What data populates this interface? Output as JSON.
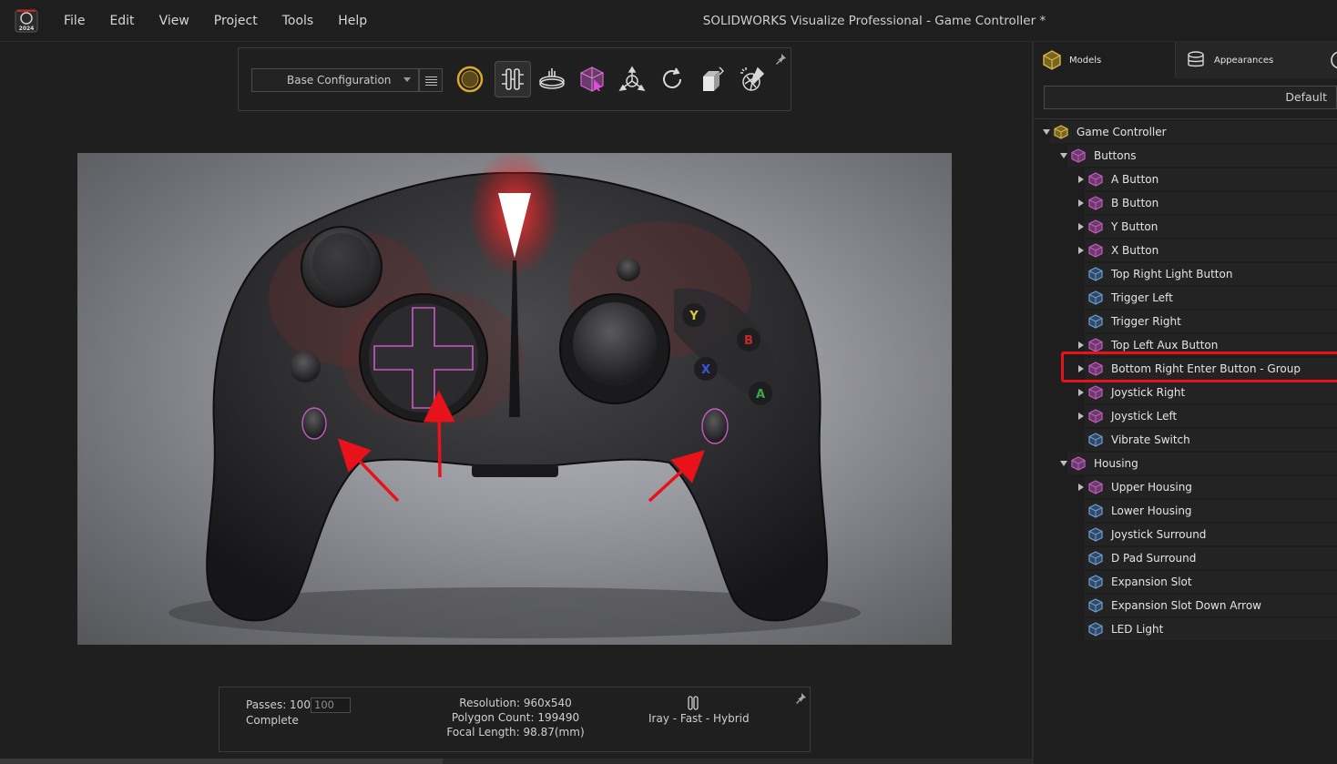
{
  "app": {
    "logo_year": "2024",
    "window_title": "SOLIDWORKS Visualize Professional - Game Controller *"
  },
  "menu": [
    "File",
    "Edit",
    "View",
    "Project",
    "Tools",
    "Help"
  ],
  "toolbar": {
    "configuration": "Base Configuration",
    "icons": [
      "render-mode-icon",
      "scene-tree-icon",
      "turntable-icon",
      "selection-tool-icon",
      "transform-tool-icon",
      "rotate-tool-icon",
      "camera-view-icon",
      "quick-render-icon"
    ]
  },
  "status": {
    "passes_label": "Passes: 100 /",
    "passes_max": "100",
    "state": "Complete",
    "resolution": "Resolution: 960x540",
    "polygons": "Polygon Count: 199490",
    "focal": "Focal Length: 98.87(mm)",
    "renderer": "Iray - Fast - Hybrid"
  },
  "render_overlay": {
    "face_buttons": [
      "Y",
      "B",
      "X",
      "A"
    ]
  },
  "right_panel": {
    "tabs": [
      "Models",
      "Appearances"
    ],
    "state": "Default",
    "tree": [
      {
        "label": "Game Controller",
        "level": 0,
        "toggle": "down",
        "icon": "model-group-icon"
      },
      {
        "label": "Buttons",
        "level": 1,
        "toggle": "down",
        "icon": "group-icon"
      },
      {
        "label": "A Button",
        "level": 2,
        "toggle": "right",
        "icon": "group-icon"
      },
      {
        "label": "B Button",
        "level": 2,
        "toggle": "right",
        "icon": "group-icon"
      },
      {
        "label": "Y Button",
        "level": 2,
        "toggle": "right",
        "icon": "group-icon"
      },
      {
        "label": "X Button",
        "level": 2,
        "toggle": "right",
        "icon": "group-icon"
      },
      {
        "label": "Top Right Light Button",
        "level": 2,
        "toggle": "none",
        "icon": "part-icon"
      },
      {
        "label": "Trigger Left",
        "level": 2,
        "toggle": "none",
        "icon": "part-icon"
      },
      {
        "label": "Trigger Right",
        "level": 2,
        "toggle": "none",
        "icon": "part-icon"
      },
      {
        "label": "Top Left Aux Button",
        "level": 2,
        "toggle": "right",
        "icon": "group-icon"
      },
      {
        "label": "Bottom Right Enter Button - Group",
        "level": 2,
        "toggle": "right",
        "icon": "group-icon",
        "highlighted": true
      },
      {
        "label": "Joystick Right",
        "level": 2,
        "toggle": "right",
        "icon": "group-icon"
      },
      {
        "label": "Joystick Left",
        "level": 2,
        "toggle": "right",
        "icon": "group-icon"
      },
      {
        "label": "Vibrate Switch",
        "level": 2,
        "toggle": "none",
        "icon": "part-icon"
      },
      {
        "label": "Housing",
        "level": 1,
        "toggle": "down",
        "icon": "group-icon"
      },
      {
        "label": "Upper Housing",
        "level": 2,
        "toggle": "right",
        "icon": "group-icon"
      },
      {
        "label": "Lower Housing",
        "level": 2,
        "toggle": "none",
        "icon": "part-icon"
      },
      {
        "label": "Joystick Surround",
        "level": 2,
        "toggle": "none",
        "icon": "part-icon"
      },
      {
        "label": "D Pad Surround",
        "level": 2,
        "toggle": "none",
        "icon": "part-icon"
      },
      {
        "label": "Expansion Slot",
        "level": 2,
        "toggle": "none",
        "icon": "part-icon"
      },
      {
        "label": "Expansion Slot  Down Arrow",
        "level": 2,
        "toggle": "none",
        "icon": "part-icon"
      },
      {
        "label": "LED Light",
        "level": 2,
        "toggle": "none",
        "icon": "part-icon"
      }
    ]
  },
  "colors": {
    "accent_yellow": "#d9b84a",
    "group_magenta": "#c65bc4",
    "part_blue": "#6f9fcf",
    "highlight_red": "#e8121b"
  }
}
